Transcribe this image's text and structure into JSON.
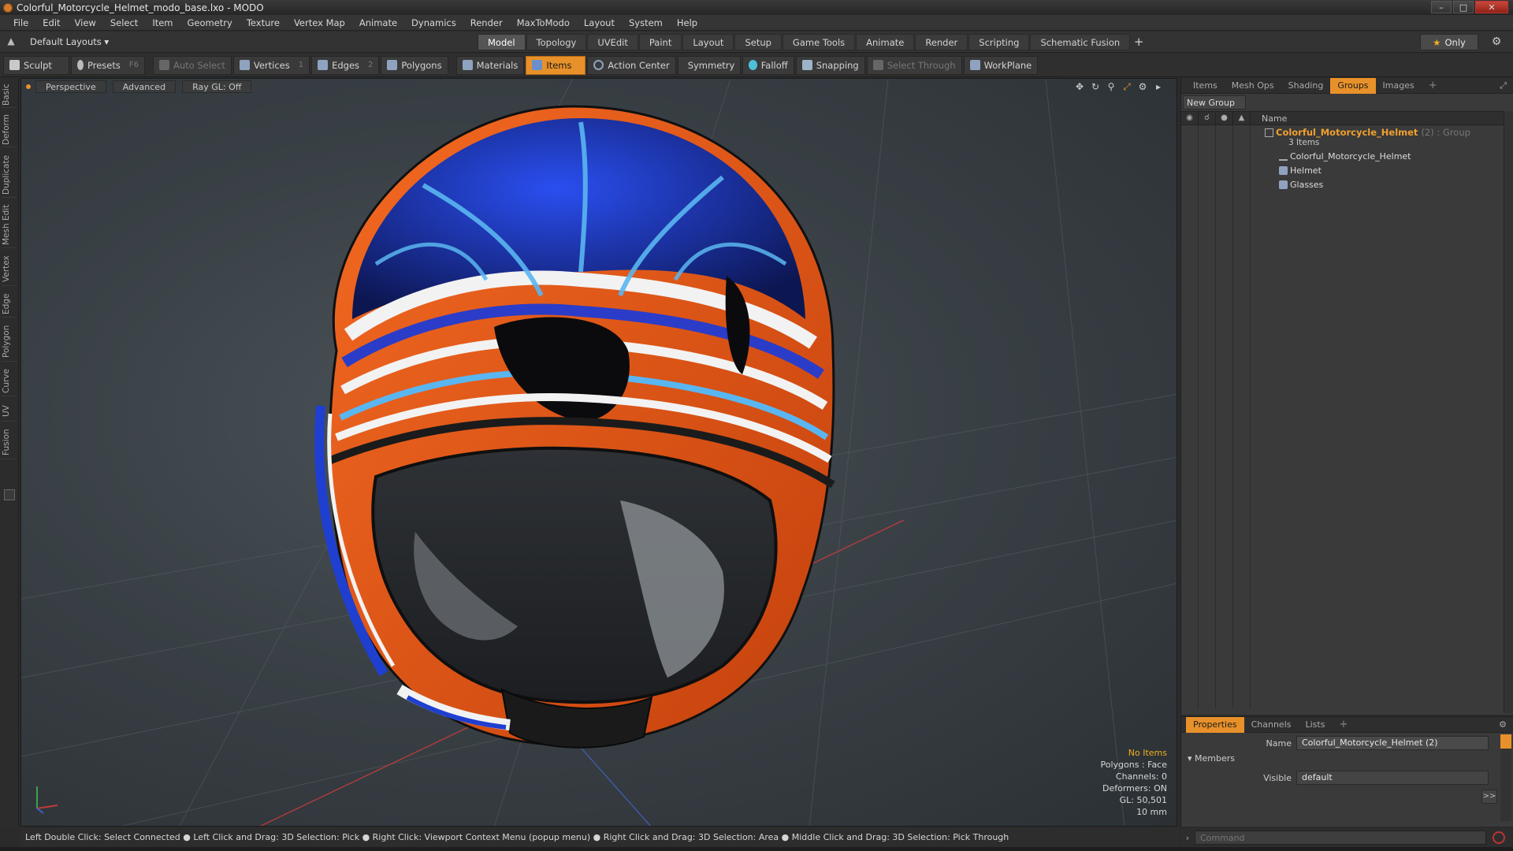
{
  "window": {
    "title": "Colorful_Motorcycle_Helmet_modo_base.lxo - MODO",
    "minimize": "–",
    "maximize": "□",
    "close": "✕"
  },
  "menu": [
    "File",
    "Edit",
    "View",
    "Select",
    "Item",
    "Geometry",
    "Texture",
    "Vertex Map",
    "Animate",
    "Dynamics",
    "Render",
    "MaxToModo",
    "Layout",
    "System",
    "Help"
  ],
  "layoutbar": {
    "layouts_dropdown": "Default Layouts ▾",
    "tabs": [
      "Model",
      "Topology",
      "UVEdit",
      "Paint",
      "Layout",
      "Setup",
      "Game Tools",
      "Animate",
      "Render",
      "Scripting",
      "Schematic Fusion"
    ],
    "active_tab": "Model",
    "plus": "+",
    "only_label": "Only",
    "star": "★"
  },
  "toolbar": {
    "sculpt": "Sculpt",
    "presets": "Presets",
    "presets_key": "F6",
    "auto_select": "Auto Select",
    "vertices": "Vertices",
    "vertices_count": "1",
    "edges": "Edges",
    "edges_count": "2",
    "polygons": "Polygons",
    "materials": "Materials",
    "items": "Items",
    "action_center": "Action Center",
    "symmetry": "Symmetry",
    "falloff": "Falloff",
    "snapping": "Snapping",
    "select_through": "Select Through",
    "workplane": "WorkPlane"
  },
  "left_tabs": [
    "Basic",
    "Deform",
    "Duplicate",
    "Mesh Edit",
    "Vertex",
    "Edge",
    "Polygon",
    "Curve",
    "UV",
    "Fusion"
  ],
  "viewport": {
    "perspective": "Perspective",
    "advanced": "Advanced",
    "ray_gl": "Ray GL: Off",
    "info": {
      "no_items": "No Items",
      "polygons": "Polygons : Face",
      "channels": "Channels: 0",
      "deformers": "Deformers: ON",
      "gl": "GL: 50,501",
      "scale": "10 mm"
    },
    "colors": {
      "orange": "#e8581c",
      "blue": "#1f3fd0",
      "light_blue": "#5ab6f0",
      "white": "#f2f2f2",
      "dark": "#2a2d31"
    }
  },
  "right_panel": {
    "tabs": [
      "Items",
      "Mesh Ops",
      "Shading",
      "Groups",
      "Images"
    ],
    "active_tab": "Groups",
    "plus": "+",
    "new_group": "New Group",
    "name_header": "Name",
    "group": {
      "name": "Colorful_Motorcycle_Helmet",
      "suffix": "(2) : Group",
      "count": "3 Items",
      "children": [
        "Colorful_Motorcycle_Helmet",
        "Helmet",
        "Glasses"
      ]
    }
  },
  "properties": {
    "tabs": [
      "Properties",
      "Channels",
      "Lists"
    ],
    "active_tab": "Properties",
    "plus": "+",
    "name_label": "Name",
    "name_value": "Colorful_Motorcycle_Helmet (2)",
    "members_label": "Members",
    "visible_label": "Visible",
    "visible_value": "default",
    "arrow": ">>"
  },
  "statusbar": {
    "text": "Left Double Click: Select Connected ● Left Click and Drag: 3D Selection: Pick ● Right Click: Viewport Context Menu (popup menu) ● Right Click and Drag: 3D Selection: Area ● Middle Click and Drag: 3D Selection: Pick Through"
  },
  "command": {
    "placeholder": "Command"
  }
}
